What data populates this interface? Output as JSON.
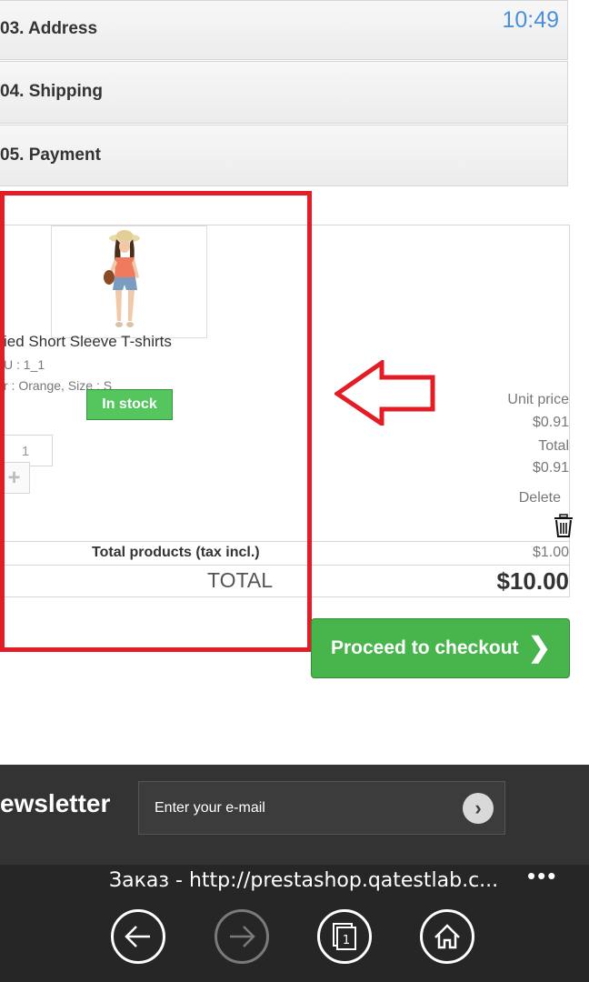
{
  "steps": {
    "address": "03. Address",
    "shipping": "04. Shipping",
    "payment": "05. Payment"
  },
  "status_bar": {
    "time": "10:49"
  },
  "cart": {
    "product_name": "ied Short Sleeve T-shirts",
    "sku": "U : 1_1",
    "attributes": "r : Orange, Size : S",
    "availability": "In stock",
    "quantity": "1",
    "unit_price_label": "Unit price",
    "unit_price": "$0.91",
    "total_label": "Total",
    "total_value": "$0.91",
    "delete_label": "Delete",
    "total_products_label": "Total products (tax incl.)",
    "total_products_value": "$1.00",
    "grand_total_label": "TOTAL",
    "grand_total_value": "$10.00"
  },
  "checkout": {
    "label": "Proceed to checkout"
  },
  "footer": {
    "newsletter_title": "ewsletter",
    "email_placeholder": "Enter your e-mail"
  },
  "browser": {
    "title_url": "Заказ - http://prestashop.qatestlab.c...",
    "more": "•••"
  },
  "annotation_color": "#e41c25",
  "accent_green": "#47b54c"
}
